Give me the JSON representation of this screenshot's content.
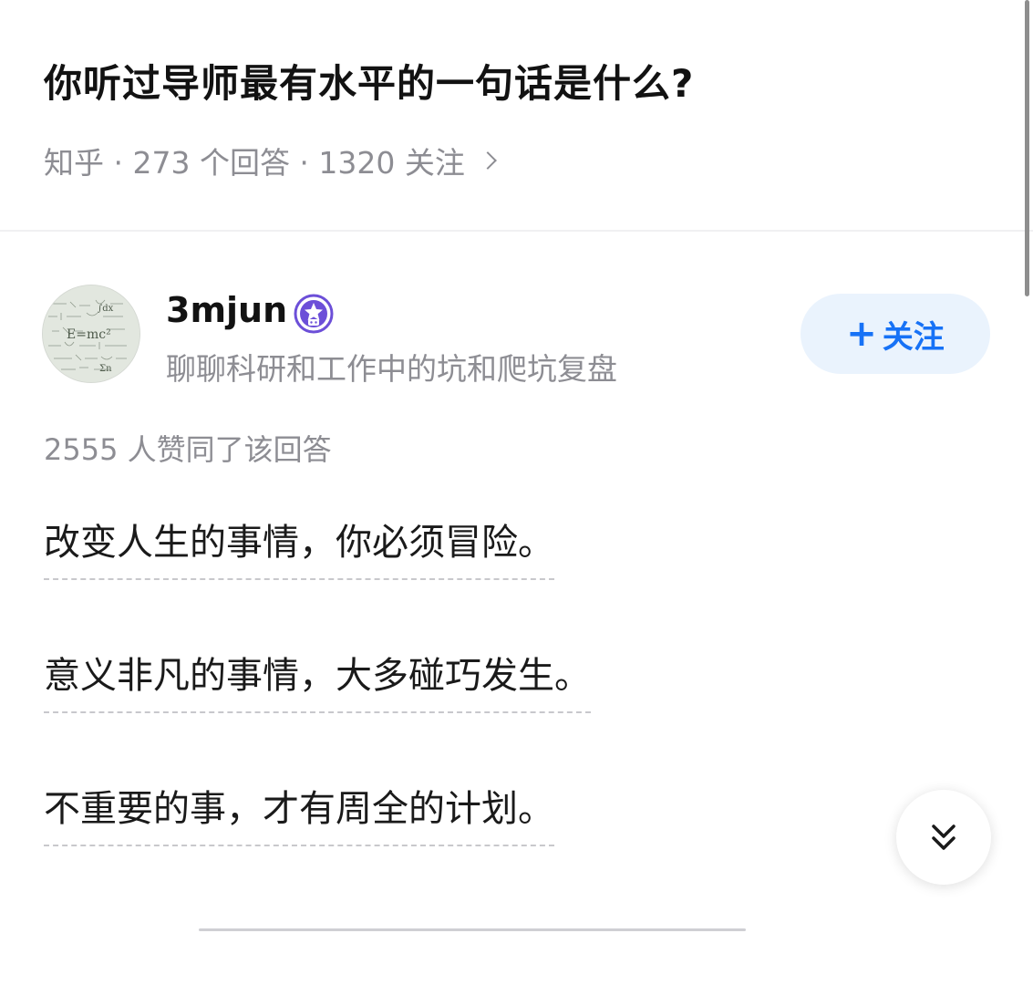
{
  "question": {
    "title": "你听过导师最有水平的一句话是什么?",
    "meta": "知乎 · 273 个回答 · 1320 关注"
  },
  "answer": {
    "author": {
      "name": "3mjun",
      "bio": "聊聊科研和工作中的坑和爬坑复盘",
      "avatar_icon": "avatar-formula-icon",
      "badge_icon": "star-badge-icon"
    },
    "follow_button": {
      "plus": "+",
      "label": "关注"
    },
    "vote_text": "2555 人赞同了该回答",
    "paragraphs": [
      "改变人生的事情，你必须冒险。",
      "意义非凡的事情，大多碰巧发生。",
      "不重要的事，才有周全的计划。"
    ],
    "scroll_button_icon": "double-chevron-down-icon"
  },
  "colors": {
    "accent": "#1772f6",
    "follow_bg": "#eaf3fd",
    "muted_text": "#8d8d93",
    "primary_text": "#121212",
    "dashed_underline": "#c8c8cc",
    "badge_purple": "#6c4fd8"
  }
}
